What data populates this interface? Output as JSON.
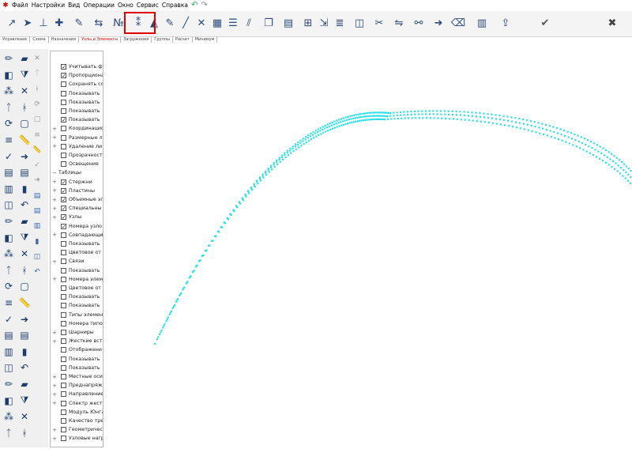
{
  "menu": {
    "app_icon": "app-logo-icon",
    "items": [
      "Файл",
      "Настройки",
      "Вид",
      "Операции",
      "Окно",
      "Сервис",
      "Справка"
    ],
    "undo_icon": "undo-icon",
    "redo_icon": "redo-icon"
  },
  "toolbar": {
    "icons": [
      "node-pointer-icon",
      "select-cursor-icon",
      "node-axis-icon",
      "add-node-icon",
      "node-tool-icon",
      "node-move-icon",
      "node-number-icon",
      "renumber-nodes-icon",
      "triangle-mesh-icon",
      "node-tool-icon",
      "line-tool-icon",
      "remove-icon",
      "select-element-icon",
      "align-icon",
      "divide-icon",
      "copy-icon",
      "grid-icon",
      "array-icon",
      "expand-icon",
      "layers-icon",
      "cube-icon",
      "split-icon",
      "mirror-icon",
      "link-icon",
      "arrow-icon",
      "delete-element-icon",
      "table-icon",
      "export-icon",
      "apply-check-icon",
      "cancel-close-icon"
    ],
    "highlight_color": "#e00000"
  },
  "tabs": [
    "Управление",
    "Схема",
    "Назначения",
    "Узлы и Элементы",
    "Загружения",
    "Группы",
    "Расчет",
    "Минимум"
  ],
  "active_tab_index": 3,
  "left_tools": {
    "icons": [
      "pencil-icon",
      "eraser-icon",
      "fill-icon",
      "filter-icon",
      "nodes-icon",
      "cross-icon",
      "node-a-icon",
      "nodes-b-icon",
      "rotate-icon",
      "square-icon",
      "lines-icon",
      "ruler-icon",
      "check-icon",
      "arrow-icon",
      "stack-icon",
      "grid-icon",
      "table-icon",
      "bar-chart-icon",
      "cube-icon",
      "undo-icon"
    ]
  },
  "tree": {
    "items": [
      {
        "label": "Учитывать ф",
        "checked": true,
        "root": false,
        "expander": ""
      },
      {
        "label": "Пропорциона",
        "checked": true,
        "root": false,
        "expander": ""
      },
      {
        "label": "Сохранять со",
        "checked": false,
        "root": false,
        "expander": ""
      },
      {
        "label": "Показывать",
        "checked": false,
        "root": false,
        "expander": ""
      },
      {
        "label": "Показывать",
        "checked": false,
        "root": false,
        "expander": ""
      },
      {
        "label": "Показывать",
        "checked": false,
        "root": false,
        "expander": ""
      },
      {
        "label": "Показывать",
        "checked": true,
        "root": false,
        "expander": ""
      },
      {
        "label": "Координацио",
        "checked": false,
        "root": false,
        "expander": "+"
      },
      {
        "label": "Размерные л",
        "checked": false,
        "root": false,
        "expander": "+"
      },
      {
        "label": "Удаление ли",
        "checked": false,
        "root": false,
        "expander": "+"
      },
      {
        "label": "Прозрачност",
        "checked": false,
        "root": false,
        "expander": ""
      },
      {
        "label": "Освещение",
        "checked": false,
        "root": false,
        "expander": ""
      },
      {
        "label": "Таблицы",
        "checked": false,
        "root": true,
        "expander": "−"
      },
      {
        "label": "Стержни",
        "checked": true,
        "root": false,
        "expander": "+"
      },
      {
        "label": "Пластины",
        "checked": true,
        "root": false,
        "expander": "+"
      },
      {
        "label": "Объемные эл",
        "checked": true,
        "root": false,
        "expander": "+"
      },
      {
        "label": "Специальны",
        "checked": true,
        "root": false,
        "expander": "+"
      },
      {
        "label": "Узлы",
        "checked": true,
        "root": false,
        "expander": "+"
      },
      {
        "label": "Номера узло",
        "checked": true,
        "root": false,
        "expander": ""
      },
      {
        "label": "Совпадающи",
        "checked": false,
        "root": false,
        "expander": "+"
      },
      {
        "label": "Показывать",
        "checked": false,
        "root": false,
        "expander": ""
      },
      {
        "label": "Цветовое от",
        "checked": false,
        "root": false,
        "expander": ""
      },
      {
        "label": "Связи",
        "checked": false,
        "root": false,
        "expander": "+"
      },
      {
        "label": "Показывать",
        "checked": false,
        "root": false,
        "expander": ""
      },
      {
        "label": "Номера элем",
        "checked": false,
        "root": false,
        "expander": "+"
      },
      {
        "label": "Цветовое от",
        "checked": false,
        "root": false,
        "expander": ""
      },
      {
        "label": "Показывать",
        "checked": false,
        "root": false,
        "expander": ""
      },
      {
        "label": "Показывать",
        "checked": false,
        "root": false,
        "expander": ""
      },
      {
        "label": "Типы элемен",
        "checked": false,
        "root": false,
        "expander": ""
      },
      {
        "label": "Номера типо",
        "checked": false,
        "root": false,
        "expander": ""
      },
      {
        "label": "Шарниры",
        "checked": false,
        "root": false,
        "expander": "+"
      },
      {
        "label": "Жесткие вста",
        "checked": false,
        "root": false,
        "expander": "+"
      },
      {
        "label": "Отображени",
        "checked": false,
        "root": false,
        "expander": ""
      },
      {
        "label": "Показывать",
        "checked": false,
        "root": false,
        "expander": ""
      },
      {
        "label": "Показывать",
        "checked": false,
        "root": false,
        "expander": ""
      },
      {
        "label": "Местные оси",
        "checked": false,
        "root": false,
        "expander": "+"
      },
      {
        "label": "Преднапряж",
        "checked": false,
        "root": false,
        "expander": "+"
      },
      {
        "label": "Направление",
        "checked": false,
        "root": false,
        "expander": "+"
      },
      {
        "label": "Спектр жестк",
        "checked": false,
        "root": false,
        "expander": "+"
      },
      {
        "label": "Модуль Юнга",
        "checked": false,
        "root": false,
        "expander": ""
      },
      {
        "label": "Качество тре",
        "checked": false,
        "root": false,
        "expander": ""
      },
      {
        "label": "Геометричес",
        "checked": false,
        "root": false,
        "expander": "+"
      },
      {
        "label": "Узловые нагр",
        "checked": false,
        "root": false,
        "expander": "+"
      }
    ]
  },
  "canvas": {
    "curve_color": "#2fe0e6"
  }
}
